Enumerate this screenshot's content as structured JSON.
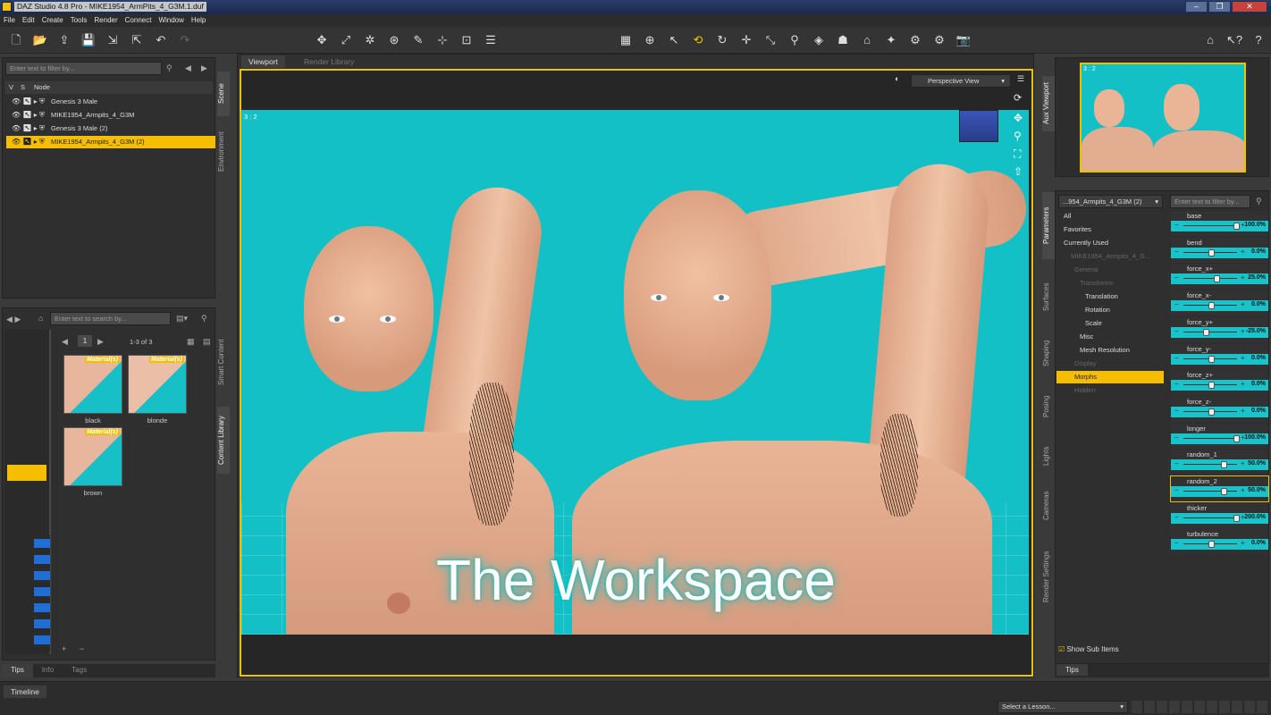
{
  "window": {
    "title": "DAZ Studio 4.8 Pro - MIKE1954_ArmPits_4_G3M.1.duf",
    "buttons": [
      "–",
      "❐",
      "✕"
    ]
  },
  "menu": [
    "File",
    "Edit",
    "Create",
    "Tools",
    "Render",
    "Connect",
    "Window",
    "Help"
  ],
  "scene": {
    "filter_placeholder": "Enter text to filter by...",
    "columns": {
      "v": "V",
      "s": "S",
      "node": "Node"
    },
    "nodes": [
      "Genesis 3 Male",
      "MIKE1954_Armpits_4_G3M",
      "Genesis 3 Male (2)",
      "MIKE1954_Armpits_4_G3M (2)"
    ],
    "tabs": [
      "Scene",
      "Environment"
    ]
  },
  "content": {
    "search_placeholder": "Enter text to search by...",
    "page": "1",
    "page_count": "1-3 of 3",
    "items": [
      {
        "name": "black",
        "badge": "Material(s)"
      },
      {
        "name": "blonde",
        "badge": "Material(s)"
      },
      {
        "name": "brown",
        "badge": "Material(s)"
      }
    ],
    "tabs": [
      "Smart Content",
      "Content Library"
    ],
    "bottom_tabs": [
      "Tips",
      "Info",
      "Tags"
    ]
  },
  "viewport": {
    "tabs": [
      "Viewport",
      "Render Library"
    ],
    "view": "Perspective View",
    "aspect": "3 : 2",
    "overlay": "The Workspace"
  },
  "aux": {
    "label": "Aux Viewport",
    "aspect": "3 : 2"
  },
  "parameters": {
    "node": "...954_Armpits_4_G3M (2)",
    "filter_placeholder": "Enter text to filter by...",
    "tree": [
      {
        "label": "All",
        "state": "normal"
      },
      {
        "label": "Favorites",
        "state": "normal"
      },
      {
        "label": "Currently Used",
        "state": "normal"
      },
      {
        "label": "MIKE1954_Armpits_4_G...",
        "state": "dim"
      },
      {
        "label": "General",
        "state": "dim"
      },
      {
        "label": "Transforms",
        "state": "dim"
      },
      {
        "label": "Translation",
        "state": "normal"
      },
      {
        "label": "Rotation",
        "state": "normal"
      },
      {
        "label": "Scale",
        "state": "normal"
      },
      {
        "label": "Misc",
        "state": "normal"
      },
      {
        "label": "Mesh Resolution",
        "state": "normal"
      },
      {
        "label": "Display",
        "state": "dim"
      },
      {
        "label": "Morphs",
        "state": "sel"
      },
      {
        "label": "Hidden",
        "state": "dim"
      }
    ],
    "show_sub_items": "Show Sub Items",
    "sliders": [
      {
        "name": "base",
        "value": "100.0%",
        "frac": 1.0
      },
      {
        "name": "bend",
        "value": "0.0%",
        "frac": 0.5
      },
      {
        "name": "force_x+",
        "value": "25.0%",
        "frac": 0.6
      },
      {
        "name": "force_x-",
        "value": "0.0%",
        "frac": 0.5
      },
      {
        "name": "force_y+",
        "value": "-25.0%",
        "frac": 0.4
      },
      {
        "name": "force_y-",
        "value": "0.0%",
        "frac": 0.5
      },
      {
        "name": "force_z+",
        "value": "0.0%",
        "frac": 0.5
      },
      {
        "name": "force_z-",
        "value": "0.0%",
        "frac": 0.5
      },
      {
        "name": "longer",
        "value": "100.0%",
        "frac": 1.0
      },
      {
        "name": "random_1",
        "value": "50.0%",
        "frac": 0.75
      },
      {
        "name": "random_2",
        "value": "50.0%",
        "frac": 0.75
      },
      {
        "name": "thicker",
        "value": "200.0%",
        "frac": 1.0
      },
      {
        "name": "turbulence",
        "value": "0.0%",
        "frac": 0.5
      }
    ],
    "tabs": [
      "Parameters",
      "Surfaces",
      "Shaping",
      "Posing",
      "Lights",
      "Cameras",
      "Render Settings"
    ],
    "bottom_tab": "Tips"
  },
  "timeline": {
    "label": "Timeline",
    "lesson_placeholder": "Select a Lesson..."
  }
}
